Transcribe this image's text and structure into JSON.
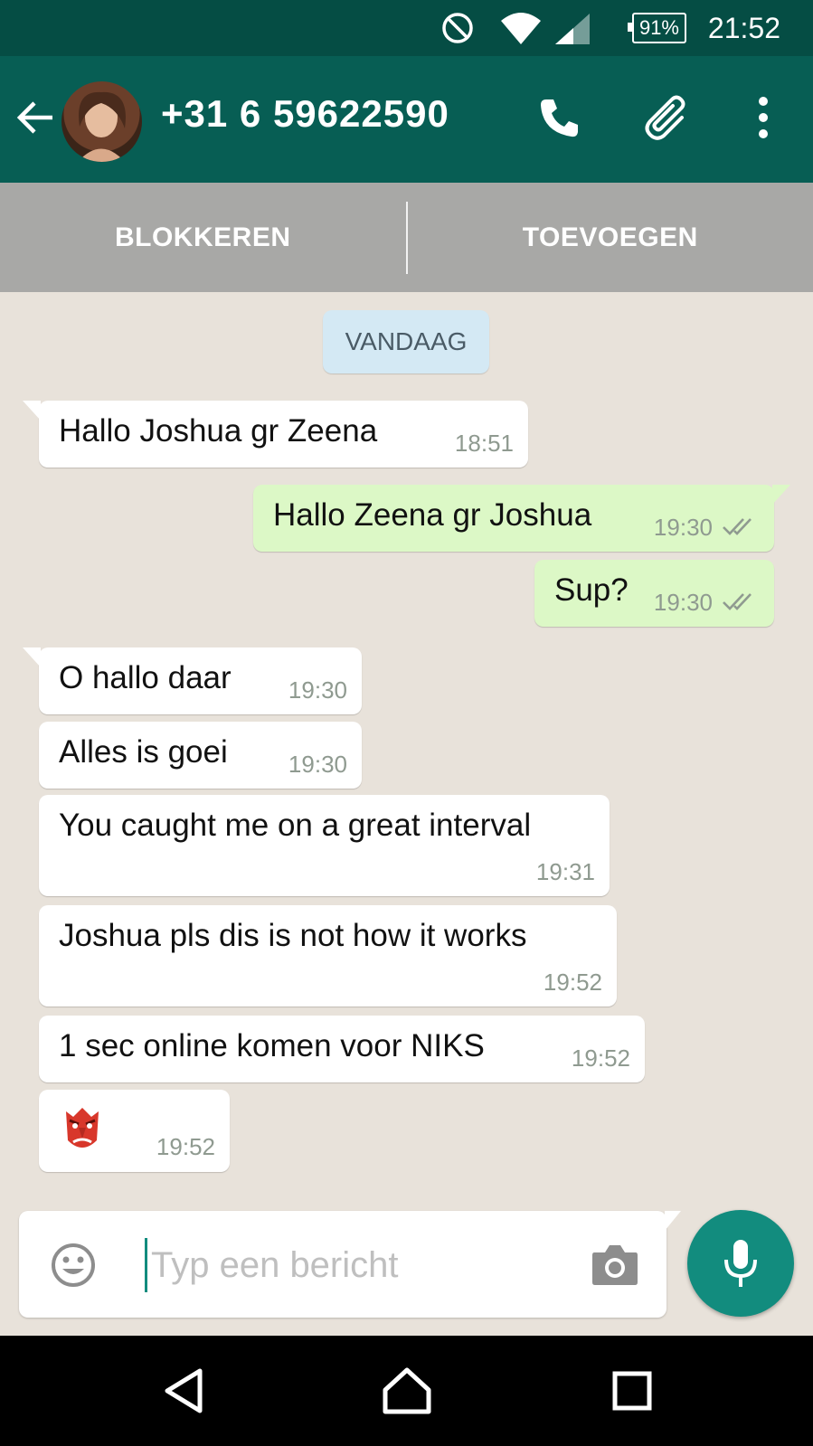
{
  "status_bar": {
    "battery": "91%",
    "time": "21:52"
  },
  "header": {
    "contact": "+31 6 59622590"
  },
  "actions": {
    "block": "BLOKKEREN",
    "add": "TOEVOEGEN"
  },
  "chat": {
    "date_label": "VANDAAG",
    "messages": [
      {
        "dir": "in",
        "text": "Hallo Joshua gr Zeena",
        "time": "18:51"
      },
      {
        "dir": "out",
        "text": "Hallo Zeena gr Joshua",
        "time": "19:30",
        "status": "read"
      },
      {
        "dir": "out",
        "text": "Sup?",
        "time": "19:30",
        "status": "read"
      },
      {
        "dir": "in",
        "text": "O hallo daar",
        "time": "19:30"
      },
      {
        "dir": "in",
        "text": "Alles is goei",
        "time": "19:30"
      },
      {
        "dir": "in",
        "text": "You caught me on a great interval",
        "time": "19:31"
      },
      {
        "dir": "in",
        "text": "Joshua pls dis is not how it works",
        "time": "19:52"
      },
      {
        "dir": "in",
        "text": "1 sec online komen voor NIKS",
        "time": "19:52"
      },
      {
        "dir": "in",
        "emoji": "goblin-emoji",
        "time": "19:52"
      }
    ]
  },
  "composer": {
    "placeholder": "Typ een bericht",
    "value": ""
  },
  "colors": {
    "status_bar": "#054d44",
    "app_bar": "#075e54",
    "accent": "#128c7e",
    "outgoing": "#dcf8c6",
    "incoming": "#ffffff"
  }
}
